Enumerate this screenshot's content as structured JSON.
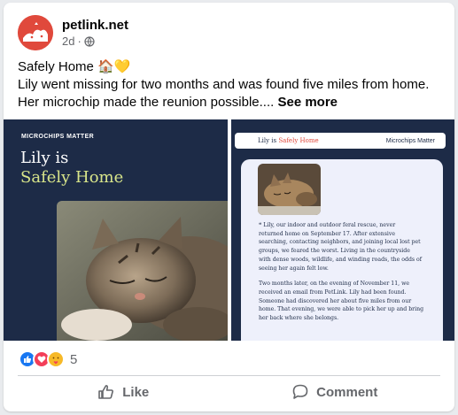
{
  "post": {
    "page_name": "petlink.net",
    "time": "2d",
    "dot": "·",
    "privacy_icon": "globe-icon",
    "text_line1": "Safely Home 🏠💛",
    "text_line2": "Lily went missing for two months and was found five miles from home.",
    "text_line3": "Her microchip made the reunion possible.... ",
    "see_more": "See more"
  },
  "slide_left": {
    "tag": "MICROCHIPS MATTER",
    "title_line1": "Lily is",
    "title_line2": "Safely Home"
  },
  "slide_right": {
    "pill_left_a": "Lily is ",
    "pill_left_b": "Safely Home",
    "pill_right": "Microchips Matter",
    "para1": [
      "❝ Lily, our indoor and outdoor feral rescue, never",
      "returned home on September 17. After extensive",
      "searching, contacting neighbors, and joining local lost pet",
      "groups, we feared the worst. Living in the countryside",
      "with dense woods, wildlife, and winding roads, the odds of",
      "seeing her again felt low."
    ],
    "para2": [
      "Two months later, on the evening of November 11, we",
      "received an email from PetLink. Lily had been found.",
      "Someone had discovered her about five miles from our",
      "home. That evening, we were able to pick her up and bring",
      "her back where she belongs."
    ]
  },
  "reactions": {
    "icons": [
      "like-icon",
      "love-icon",
      "care-icon"
    ],
    "count": "5"
  },
  "actions": {
    "like": "Like",
    "comment": "Comment"
  },
  "colors": {
    "brand_red": "#e0493c",
    "navy": "#1d2b47",
    "accent_yellow": "#d8e58a",
    "like_blue": "#1877f2",
    "love_red": "#f33e58"
  }
}
